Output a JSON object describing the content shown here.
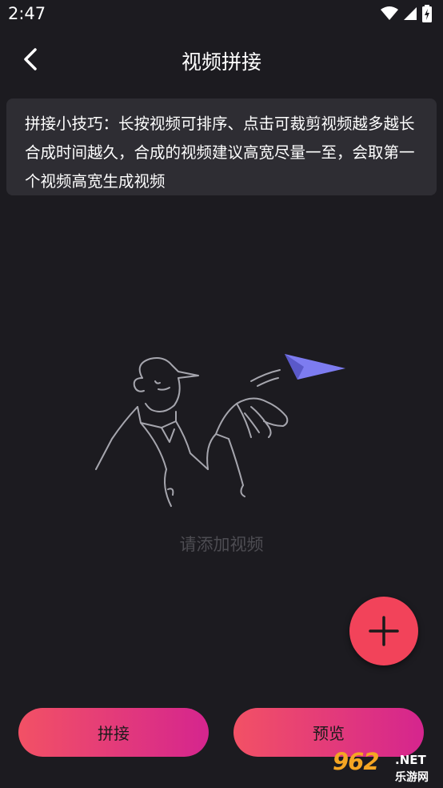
{
  "status": {
    "time": "2:47"
  },
  "header": {
    "title": "视频拼接"
  },
  "tip": {
    "text": "拼接小技巧：长按视频可排序、点击可裁剪视频越多越长合成时间越久，合成的视频建议高宽尽量一至，会取第一个视频高宽生成视频"
  },
  "empty_state": {
    "text": "请添加视频"
  },
  "actions": {
    "join_label": "拼接",
    "preview_label": "预览"
  },
  "watermark": {
    "main": "962",
    "net": ".NET",
    "sub": "乐游网"
  },
  "colors": {
    "background": "#1c1b20",
    "card": "#2e2d33",
    "accent": "#f2435a",
    "gradient_end": "#d5258e",
    "plane": "#7d7cf0"
  }
}
